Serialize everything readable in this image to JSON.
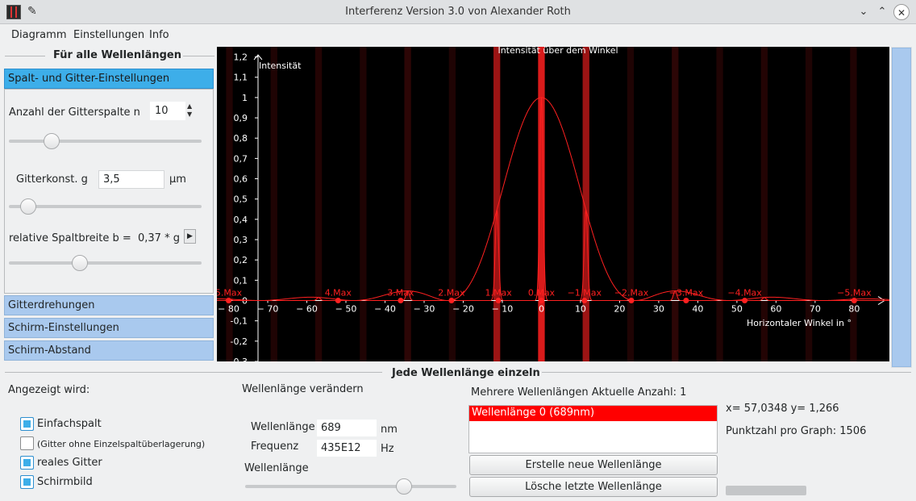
{
  "window": {
    "title": "Interferenz    Version  3.0    von  Alexander  Roth"
  },
  "menu": [
    "Diagramm",
    "Einstellungen",
    "Info"
  ],
  "left": {
    "group_title": "Für alle Wellenlängen",
    "sections": [
      "Spalt- und Gitter-Einstellungen",
      "Gitterdrehungen",
      "Schirm-Einstellungen",
      "Schirm-Abstand"
    ],
    "slit_count_label": "Anzahl der Gitterspalte  n",
    "slit_count_value": "10",
    "grating_const_label": "Gitterkonst. g",
    "grating_const_value": "3,5",
    "grating_unit": "µm",
    "slit_width_label": "relative Spaltbreite b =",
    "slit_width_value": "0,37 * g",
    "sliders": {
      "slit_count": 0.22,
      "grating_const": 0.1,
      "slit_width": 0.37
    }
  },
  "chart_data": {
    "type": "line",
    "title": "Intensität über dem Winkel",
    "ylabel": "Intensität",
    "xlabel": "Horizontaler Winkel in °",
    "xlim": [
      -83,
      89
    ],
    "ylim": [
      -0.3,
      1.25
    ],
    "x_ticks": [
      "-80",
      "-70",
      "-60",
      "-50",
      "-40",
      "-30",
      "-20",
      "-10",
      "0",
      "10",
      "20",
      "30",
      "40",
      "50",
      "60",
      "70",
      "80"
    ],
    "y_ticks": [
      "1,2",
      "1,1",
      "1",
      "0,9",
      "0,8",
      "0,7",
      "0,6",
      "0,5",
      "0,4",
      "0,3",
      "0,2",
      "0,1",
      "0",
      "-0,1",
      "-0,2",
      "-0,3"
    ],
    "max_labels": [
      {
        "label": "5.Max",
        "x": -80
      },
      {
        "label": "4.Max",
        "x": -52
      },
      {
        "label": "3.Max",
        "x": -36
      },
      {
        "label": "2.Max",
        "x": -23
      },
      {
        "label": "1.Max",
        "x": -11
      },
      {
        "label": "0.Max",
        "x": 0
      },
      {
        "label": "−1.Max",
        "x": 11
      },
      {
        "label": "−2.Max",
        "x": 23
      },
      {
        "label": "−3.Max",
        "x": 37
      },
      {
        "label": "−4.Max",
        "x": 52
      },
      {
        "label": "−5.Max",
        "x": 80
      }
    ],
    "envelope": {
      "peak": 1.0,
      "zero_angle": 24,
      "color": "#ff2020"
    },
    "grating": {
      "order_spacing_deg": 11.4,
      "peak_width_deg": 1.3
    }
  },
  "bottom": {
    "group_title": "Jede Wellenlänge einzeln",
    "shown_label": "Angezeigt wird:",
    "checkboxes": [
      {
        "label": "Einfachspalt",
        "checked": true
      },
      {
        "label": "(Gitter ohne Einzelspaltüberlagerung)",
        "checked": false
      },
      {
        "label": "reales Gitter",
        "checked": true
      },
      {
        "label": "Schirmbild",
        "checked": true
      }
    ],
    "change_label": "Wellenlänge verändern",
    "wavelength_label": "Wellenlänge",
    "wavelength_value": "689",
    "wavelength_unit": "nm",
    "freq_label": "Frequenz",
    "freq_value": "435E12",
    "freq_unit": "Hz",
    "slider_label": "Wellenlänge",
    "wavelength_slider": 0.75,
    "multi_label": "Mehrere Wellenlängen   Aktuelle Anzahl: 1",
    "list": [
      "Wellenlänge 0     (689nm)"
    ],
    "new_button": "Erstelle neue Wellenlänge",
    "delete_button": "Lösche letzte Wellenlänge",
    "coords": "x= 57,0348  y= 1,266",
    "points": "Punktzahl pro Graph: 1506"
  },
  "colors": {
    "accent": "#3daee9",
    "curve": "#ff2020",
    "selection": "#ff0000"
  }
}
